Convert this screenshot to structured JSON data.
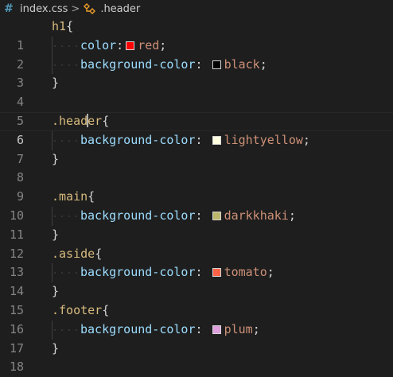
{
  "breadcrumb": {
    "file_icon": "#",
    "file_name": "index.css",
    "separator": ">",
    "symbol_icon": "css-selector-icon",
    "symbol_name": ".header"
  },
  "lines": [
    {
      "n": "1",
      "sel": "h1",
      "open": "{"
    },
    {
      "n": "2",
      "prop": "color",
      "colon": ":",
      "color": "#ff0000",
      "val": "red",
      "semi": ";"
    },
    {
      "n": "3",
      "prop": "background-color",
      "colon": ":",
      "color": "#000000",
      "val": "black",
      "semi": ";"
    },
    {
      "n": "4",
      "close": "}"
    },
    {
      "n": "5"
    },
    {
      "n": "6",
      "sel_a": ".head",
      "sel_b": "er",
      "open": "{"
    },
    {
      "n": "7",
      "prop": "background-color",
      "colon": ":",
      "color": "#ffffe0",
      "val": "lightyellow",
      "semi": ";"
    },
    {
      "n": "8",
      "close": "}"
    },
    {
      "n": "9"
    },
    {
      "n": "10",
      "sel": ".main",
      "open": "{"
    },
    {
      "n": "11",
      "prop": "background-color",
      "colon": ":",
      "color": "#bdb76b",
      "val": "darkkhaki",
      "semi": ";"
    },
    {
      "n": "12",
      "close": "}"
    },
    {
      "n": "13",
      "sel": ".aside",
      "open": "{"
    },
    {
      "n": "14",
      "prop": "background-color",
      "colon": ":",
      "color": "#ff6347",
      "val": "tomato",
      "semi": ";"
    },
    {
      "n": "15",
      "close": "}"
    },
    {
      "n": "16",
      "sel": ".footer",
      "open": "{"
    },
    {
      "n": "17",
      "prop": "background-color",
      "colon": ":",
      "color": "#dda0dd",
      "val": "plum",
      "semi": ";"
    },
    {
      "n": "18",
      "close": "}"
    }
  ]
}
